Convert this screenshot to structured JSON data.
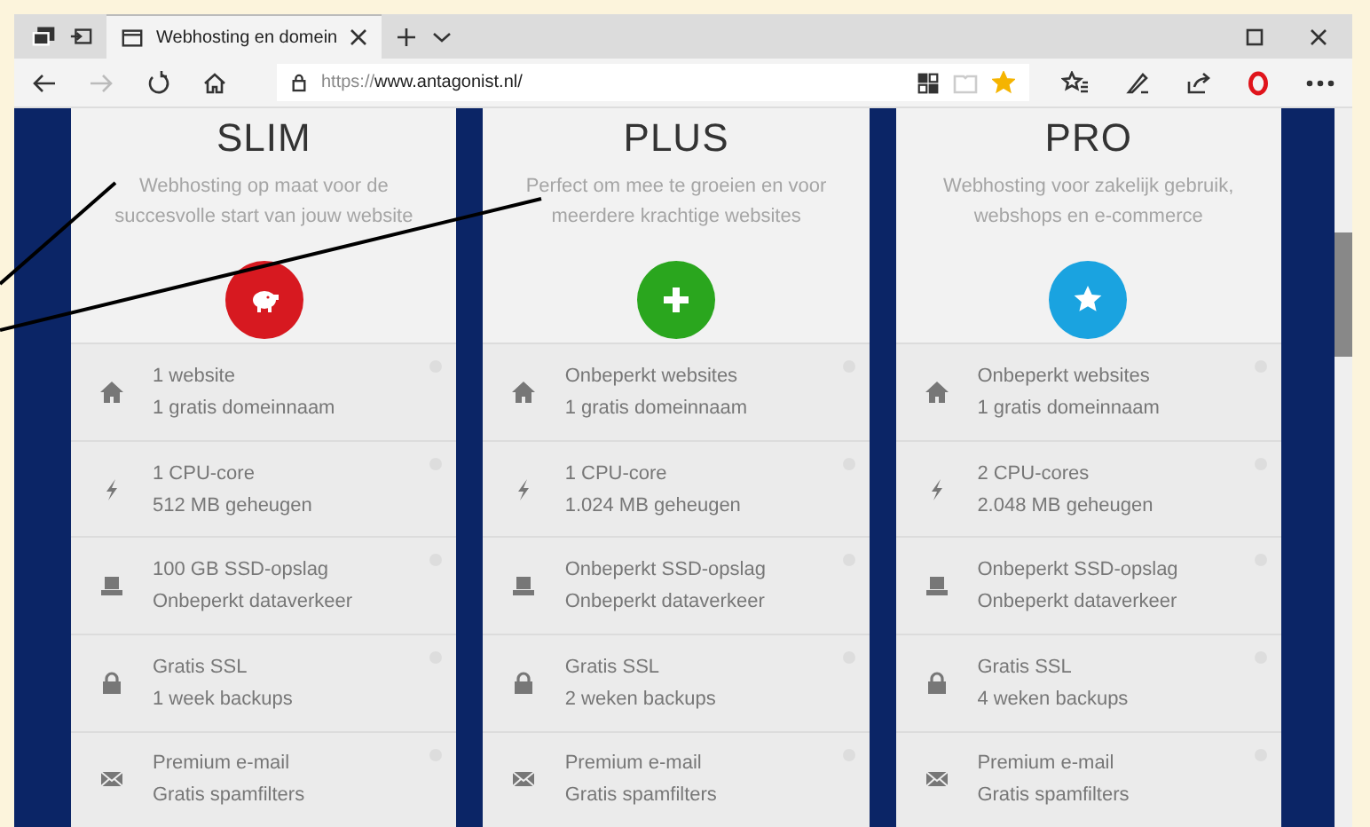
{
  "browser": {
    "tabs": [
      {
        "title": "Webhosting en domein",
        "selected": true
      }
    ],
    "nav": [
      {
        "kind": "back",
        "disabled": false
      },
      {
        "kind": "forward",
        "disabled": true
      },
      {
        "kind": "refresh",
        "disabled": false
      },
      {
        "kind": "home",
        "disabled": false
      }
    ],
    "url_scheme": "https://",
    "url_host": "www.antagonist.nl/",
    "favorite": true
  },
  "plans": [
    {
      "name": "SLIM",
      "description": "Webhosting op maat voor de succesvolle start van jouw website",
      "kind": "piggy",
      "color": "#d71920",
      "features": [
        {
          "kind": "home",
          "lines": [
            "1 website",
            "1 gratis domeinnaam"
          ]
        },
        {
          "kind": "bolt",
          "lines": [
            "1 CPU-core",
            "512 MB geheugen"
          ]
        },
        {
          "kind": "drive",
          "lines": [
            "100 GB SSD-opslag",
            "Onbeperkt dataverkeer"
          ]
        },
        {
          "kind": "lock",
          "lines": [
            "Gratis SSL",
            "1 week backups"
          ]
        },
        {
          "kind": "mail",
          "lines": [
            "Premium e-mail",
            "Gratis spamfilters"
          ]
        }
      ]
    },
    {
      "name": "PLUS",
      "description": "Perfect om mee te groeien en voor meerdere krachtige websites",
      "kind": "plus",
      "color": "#2aa61e",
      "features": [
        {
          "kind": "home",
          "lines": [
            "Onbeperkt websites",
            "1 gratis domeinnaam"
          ]
        },
        {
          "kind": "bolt",
          "lines": [
            "1 CPU-core",
            "1.024 MB geheugen"
          ]
        },
        {
          "kind": "drive",
          "lines": [
            "Onbeperkt SSD-opslag",
            "Onbeperkt dataverkeer"
          ]
        },
        {
          "kind": "lock",
          "lines": [
            "Gratis SSL",
            "2 weken backups"
          ]
        },
        {
          "kind": "mail",
          "lines": [
            "Premium e-mail",
            "Gratis spamfilters"
          ]
        }
      ]
    },
    {
      "name": "PRO",
      "description": "Webhosting voor zakelijk gebruik, webshops en e-commerce",
      "kind": "star",
      "color": "#1aa3e0",
      "features": [
        {
          "kind": "home",
          "lines": [
            "Onbeperkt websites",
            "1 gratis domeinnaam"
          ]
        },
        {
          "kind": "bolt",
          "lines": [
            "2 CPU-cores",
            "2.048 MB geheugen"
          ]
        },
        {
          "kind": "drive",
          "lines": [
            "Onbeperkt SSD-opslag",
            "Onbeperkt dataverkeer"
          ]
        },
        {
          "kind": "lock",
          "lines": [
            "Gratis SSL",
            "4 weken backups"
          ]
        },
        {
          "kind": "mail",
          "lines": [
            "Premium e-mail",
            "Gratis spamfilters"
          ]
        }
      ]
    }
  ]
}
